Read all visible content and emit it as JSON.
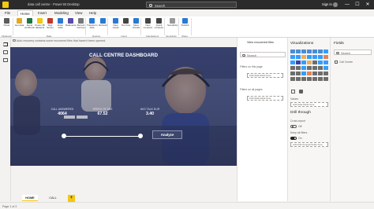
{
  "titlebar": {
    "title": "data call centre - Power BI Desktop",
    "search_placeholder": "Search",
    "signin": "Sign in",
    "window_buttons": [
      "—",
      "☐",
      "✕"
    ]
  },
  "menu": {
    "tabs": [
      "File",
      "Home",
      "Insert",
      "Modeling",
      "View",
      "Help"
    ],
    "active": "Home"
  },
  "ribbon": {
    "buttons": [
      {
        "label": "Paste",
        "color": "#5c5c5c"
      },
      {
        "label": "Get data",
        "color": "#e2a927"
      },
      {
        "label": "Excel workbook",
        "color": "#217346"
      },
      {
        "label": "Power BI datasets",
        "color": "#f2c811"
      },
      {
        "label": "SQL Server",
        "color": "#c0392b"
      },
      {
        "label": "Enter data",
        "color": "#2b79d0"
      },
      {
        "label": "Dataverse",
        "color": "#5b4ca8"
      },
      {
        "label": "Recent sources",
        "color": "#777777"
      },
      {
        "label": "Transform data",
        "color": "#2b79d0"
      },
      {
        "label": "Refresh",
        "color": "#2b79d0"
      },
      {
        "label": "New visual",
        "color": "#2b79d0"
      },
      {
        "label": "Text box",
        "color": "#444444"
      },
      {
        "label": "More visuals",
        "color": "#2b79d0"
      },
      {
        "label": "New measure",
        "color": "#444444"
      },
      {
        "label": "Quick measure",
        "color": "#444444"
      },
      {
        "label": "Sensitivity",
        "color": "#999999"
      },
      {
        "label": "Publish",
        "color": "#2b79d0"
      }
    ],
    "groups": [
      "Clipboard",
      "Data",
      "Queries",
      "Insert",
      "Calculations",
      "Sensitivity",
      "Share"
    ]
  },
  "notification": "Auto recovery contains some recovered files that haven't been opened.",
  "dashboard": {
    "title": "CALL CENTRE DASHBOARD",
    "kpis": [
      {
        "label": "CALL ANSWERED",
        "value": "4064"
      },
      {
        "label": "SPEED OF ANS",
        "value": "67.52"
      },
      {
        "label": "AVG TALK DUR",
        "value": "3.40"
      }
    ],
    "analyze_label": "Analyze"
  },
  "filters": {
    "header": "View recovered files",
    "search_placeholder": "Search",
    "on_this_page": "Filters on this page",
    "add_fields_1": "Add data fields here",
    "on_all_pages": "Filters on all pages",
    "add_fields_2": "Add data fields here"
  },
  "visualizations": {
    "header": "Visualizations",
    "values_label": "Values",
    "values_drop": "Add data fields here",
    "drill_through": "Drill through",
    "cross_report": "Cross-report",
    "cross_toggle": "Off",
    "keep_all_filters": "Keep all filters",
    "keep_toggle": "On",
    "drill_drop": "Add drill-through fields here"
  },
  "fields": {
    "header": "Fields",
    "search_placeholder": "Search",
    "tables": [
      "Call Centre"
    ]
  },
  "pages": {
    "tabs": [
      "HOME",
      "CALL CENTRE"
    ],
    "active": "HOME",
    "add_label": "+"
  },
  "status": "Page 1 of 2"
}
